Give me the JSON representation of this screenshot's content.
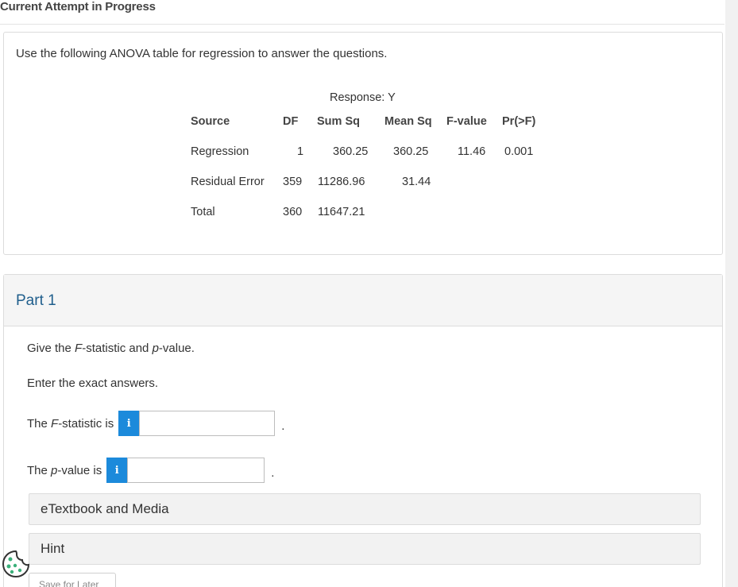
{
  "header": {
    "title": "Current Attempt in Progress"
  },
  "question": {
    "prompt": "Use the following ANOVA table for regression to answer the questions.",
    "anova": {
      "response_label": "Response: Y",
      "headers": [
        "Source",
        "DF",
        "Sum Sq",
        "Mean Sq",
        "F-value",
        "Pr(>F)"
      ],
      "rows": [
        {
          "source": "Regression",
          "df": "1",
          "sum_sq": "360.25",
          "mean_sq": "360.25",
          "f_value": "11.46",
          "pr": "0.001"
        },
        {
          "source": "Residual Error",
          "df": "359",
          "sum_sq": "11286.96",
          "mean_sq": "31.44",
          "f_value": "",
          "pr": ""
        },
        {
          "source": "Total",
          "df": "360",
          "sum_sq": "11647.21",
          "mean_sq": "",
          "f_value": "",
          "pr": ""
        }
      ]
    }
  },
  "part1": {
    "title": "Part 1",
    "instruction_prefix": "Give the ",
    "instruction_f": "F",
    "instruction_mid": "-statistic and ",
    "instruction_p": "p",
    "instruction_suffix": "-value.",
    "exact_note": "Enter the exact answers.",
    "f_label_prefix": "The ",
    "f_label_italic": "F",
    "f_label_suffix": "-statistic is",
    "f_value": "",
    "p_label_prefix": "The ",
    "p_label_italic": "p",
    "p_label_suffix": "-value is",
    "p_value": "",
    "info_glyph": "i",
    "period": ".",
    "etextbook_label": "eTextbook and Media",
    "hint_label": "Hint",
    "save_later_label": "Save for Later"
  },
  "colors": {
    "accent": "#1c8adb",
    "part_title": "#1f5e8c"
  },
  "icons": {
    "info": "info-icon",
    "cookie": "cookie-settings-icon"
  }
}
